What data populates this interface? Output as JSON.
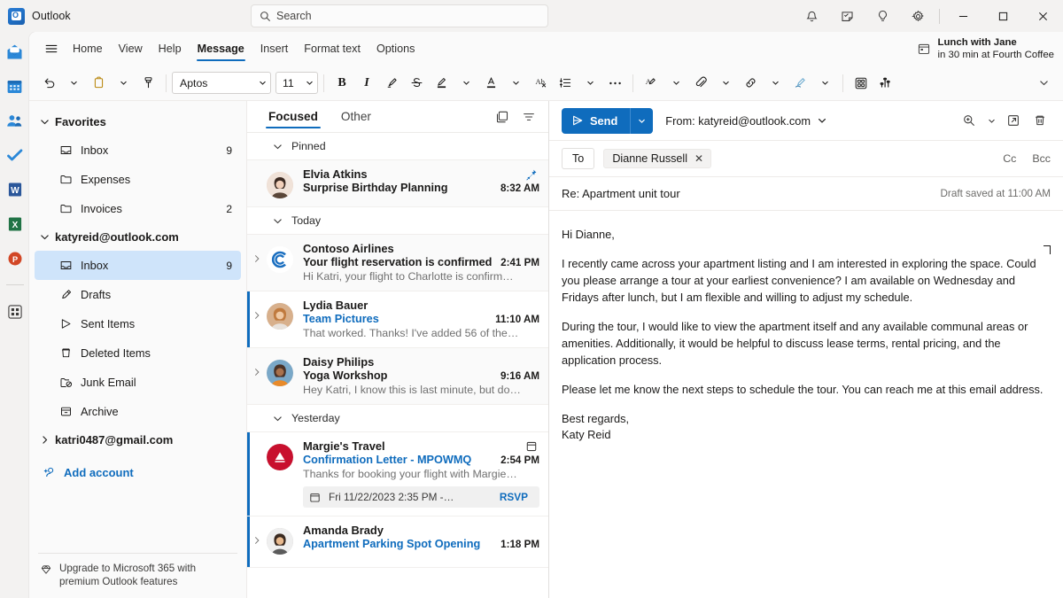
{
  "titlebar": {
    "app_name": "Outlook",
    "search_placeholder": "Search",
    "icons": [
      "bell-icon",
      "tasks-note-icon",
      "lightbulb-icon",
      "gear-icon"
    ],
    "window_buttons": {
      "minimize": "–",
      "maximize": "□",
      "close": "✕"
    }
  },
  "app_rail": {
    "items": [
      {
        "name": "mail-app-icon",
        "label": "Mail"
      },
      {
        "name": "calendar-app-icon",
        "label": "Calendar"
      },
      {
        "name": "people-app-icon",
        "label": "People"
      },
      {
        "name": "todo-app-icon",
        "label": "To Do"
      },
      {
        "name": "word-app-icon",
        "label": "Word"
      },
      {
        "name": "excel-app-icon",
        "label": "Excel"
      },
      {
        "name": "powerpoint-app-icon",
        "label": "PowerPoint"
      },
      {
        "name": "more-apps-icon",
        "label": "More apps"
      }
    ]
  },
  "ribbon": {
    "tabs": [
      {
        "label": "Home",
        "active": false
      },
      {
        "label": "View",
        "active": false
      },
      {
        "label": "Help",
        "active": false
      },
      {
        "label": "Message",
        "active": true
      },
      {
        "label": "Insert",
        "active": false
      },
      {
        "label": "Format text",
        "active": false
      },
      {
        "label": "Options",
        "active": false
      }
    ],
    "meeting_reminder": {
      "title": "Lunch with Jane",
      "subtitle": "in 30 min at Fourth Coffee",
      "icon": "calendar-event-icon"
    },
    "font_name": "Aptos",
    "font_size": "11",
    "tools": [
      "undo-icon",
      "paste-icon",
      "format-painter-icon",
      "bold-icon",
      "italic-icon",
      "highlighter-pen-icon",
      "strikethrough-icon",
      "text-highlight-color-icon",
      "font-color-icon",
      "clear-formatting-icon",
      "list-icon",
      "more-formatting-icon",
      "editor-icon",
      "attach-icon",
      "link-icon",
      "signature-icon",
      "table-icon",
      "poll-icon"
    ]
  },
  "sidebar": {
    "groups": [
      {
        "name": "Favorites",
        "expanded": true,
        "items": [
          {
            "label": "Inbox",
            "count": "9",
            "icon": "inbox-icon",
            "selected": false
          },
          {
            "label": "Expenses",
            "count": "",
            "icon": "folder-icon",
            "selected": false
          },
          {
            "label": "Invoices",
            "count": "2",
            "icon": "folder-icon",
            "selected": false
          }
        ]
      },
      {
        "name": "katyreid@outlook.com",
        "expanded": true,
        "items": [
          {
            "label": "Inbox",
            "count": "9",
            "icon": "inbox-icon",
            "selected": true
          },
          {
            "label": "Drafts",
            "count": "",
            "icon": "drafts-icon",
            "selected": false
          },
          {
            "label": "Sent Items",
            "count": "",
            "icon": "sent-icon",
            "selected": false
          },
          {
            "label": "Deleted Items",
            "count": "",
            "icon": "trash-icon",
            "selected": false
          },
          {
            "label": "Junk Email",
            "count": "",
            "icon": "junk-icon",
            "selected": false
          },
          {
            "label": "Archive",
            "count": "",
            "icon": "archive-icon",
            "selected": false
          }
        ]
      },
      {
        "name": "katri0487@gmail.com",
        "expanded": false,
        "items": []
      }
    ],
    "add_account": "Add account",
    "upgrade_text": "Upgrade to Microsoft 365 with premium Outlook features"
  },
  "message_list": {
    "pivots": [
      {
        "label": "Focused",
        "active": true
      },
      {
        "label": "Other",
        "active": false
      }
    ],
    "header_icons": [
      "new-message-icon",
      "filter-icon"
    ],
    "groups": [
      {
        "title": "Pinned",
        "messages": [
          {
            "from": "Elvia Atkins",
            "subject": "Surprise Birthday Planning",
            "preview": "",
            "time": "8:32 AM",
            "state": "read",
            "avatar_color": "#8a6d5a",
            "avatar_type": "photo",
            "pinned": true,
            "expandable": false,
            "subject_link": false
          }
        ]
      },
      {
        "title": "Today",
        "messages": [
          {
            "from": "Contoso Airlines",
            "subject": "Your flight reservation is confirmed",
            "preview": "Hi Katri, your flight to Charlotte is confirm…",
            "time": "2:41 PM",
            "state": "read",
            "avatar_color": "#0f6cbd",
            "avatar_type": "contoso",
            "pinned": false,
            "expandable": true,
            "subject_link": false
          },
          {
            "from": "Lydia Bauer",
            "subject": "Team Pictures",
            "preview": "That worked. Thanks! I've added 56 of the…",
            "time": "11:10 AM",
            "state": "unread",
            "avatar_color": "#b07b52",
            "avatar_type": "photo",
            "pinned": false,
            "expandable": true,
            "subject_link": true
          },
          {
            "from": "Daisy Philips",
            "subject": "Yoga Workshop",
            "preview": "Hey Katri, I know this is last minute, but do…",
            "time": "9:16 AM",
            "state": "read",
            "avatar_color": "#6b4a3a",
            "avatar_type": "photo",
            "pinned": false,
            "expandable": true,
            "subject_link": false
          }
        ]
      },
      {
        "title": "Yesterday",
        "messages": [
          {
            "from": "Margie's Travel",
            "subject": "Confirmation Letter - MPOWMQ",
            "preview": "Thanks for booking your flight with Margie…",
            "time": "2:54 PM",
            "state": "unread",
            "avatar_color": "#c8102e",
            "avatar_type": "margies",
            "pinned": false,
            "expandable": false,
            "subject_link": true,
            "flag_icon": "calendar-flag-icon",
            "rsvp": {
              "when": "Fri 11/22/2023 2:35 PM -…",
              "button": "RSVP"
            }
          },
          {
            "from": "Amanda Brady",
            "subject": "Apartment Parking Spot Opening",
            "preview": "",
            "time": "1:18 PM",
            "state": "unread",
            "avatar_color": "#8a6d5a",
            "avatar_type": "photo",
            "pinned": false,
            "expandable": true,
            "subject_link": true
          }
        ]
      }
    ]
  },
  "compose": {
    "send_label": "Send",
    "from_label": "From: katyreid@outlook.com",
    "toolbar_icons": [
      "zoom-in-icon",
      "popout-icon",
      "trash-icon"
    ],
    "to_label": "To",
    "recipients": [
      {
        "name": "Dianne Russell"
      }
    ],
    "cc_label": "Cc",
    "bcc_label": "Bcc",
    "subject": "Re: Apartment unit tour",
    "draft_status": "Draft saved at 11:00 AM",
    "body_paragraphs": [
      "Hi Dianne,",
      "I recently came across your apartment listing and I am interested in exploring the space. Could you please arrange a tour at your earliest convenience? I am available on Wednesday and Fridays after lunch, but I am flexible and willing to adjust my schedule.",
      "During the tour, I would like to view the apartment itself and any available communal areas or amenities. Additionally, it would be helpful to discuss lease terms, rental pricing, and the application process.",
      "Please let me know the next steps to schedule the tour. You can reach me at this email address.",
      "Best regards,",
      "Katy Reid"
    ]
  },
  "colors": {
    "accent": "#0f6cbd",
    "selection": "#cfe4fa",
    "unread_bar": "#0f6cbd",
    "chrome_bg": "#f3f2f1",
    "panel_bg": "#ffffff"
  }
}
